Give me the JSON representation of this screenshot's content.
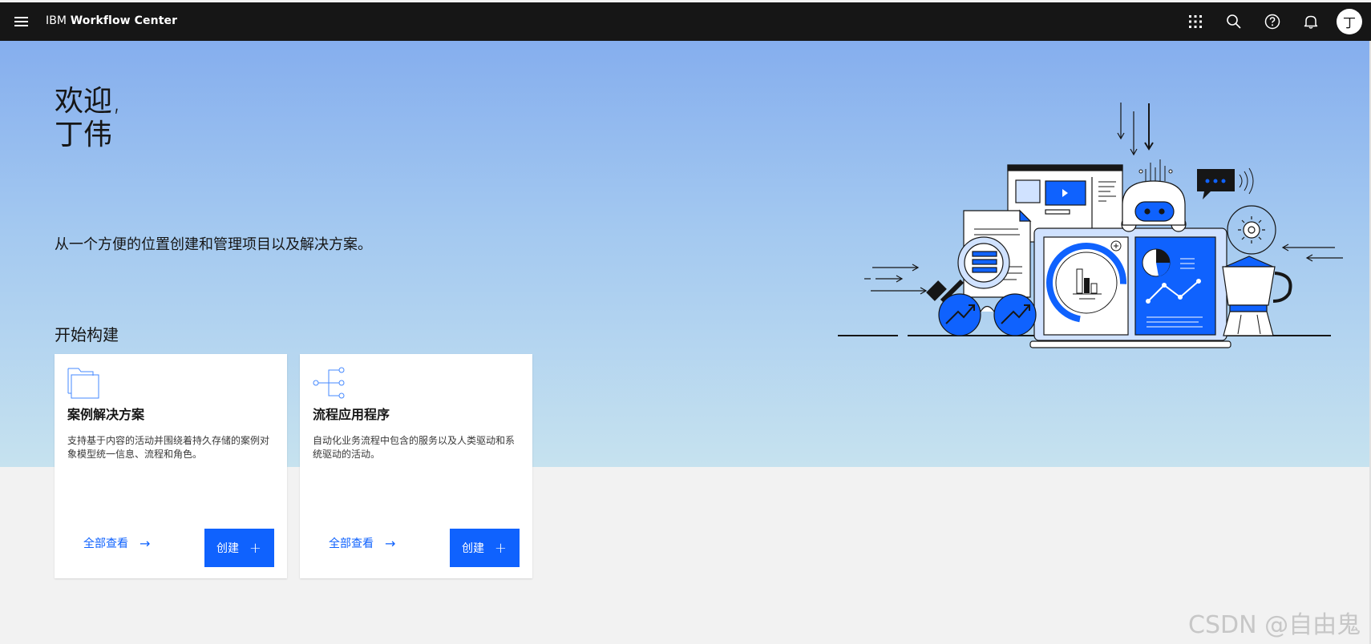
{
  "header": {
    "brand_prefix": "IBM",
    "brand_name": "Workflow Center",
    "avatar_initial": "丁",
    "icons": [
      "menu-icon",
      "app-switcher-icon",
      "search-icon",
      "help-icon",
      "notification-icon",
      "user-avatar"
    ]
  },
  "hero": {
    "welcome_line1": "欢迎,",
    "welcome_line2": "丁伟",
    "subtitle": "从一个方便的位置创建和管理项目以及解决方案。",
    "section_title": "开始构建"
  },
  "cards": [
    {
      "icon": "folder-icon",
      "title": "案例解决方案",
      "description": "支持基于内容的活动并围绕着持久存储的案例对象模型统一信息、流程和角色。",
      "view_all_label": "全部查看",
      "create_label": "创建"
    },
    {
      "icon": "flow-icon",
      "title": "流程应用程序",
      "description": "自动化业务流程中包含的服务以及人类驱动和系统驱动的活动。",
      "view_all_label": "全部查看",
      "create_label": "创建"
    }
  ],
  "watermark": "CSDN @自由鬼",
  "colors": {
    "topbar": "#161616",
    "primary": "#0f62fe",
    "hero_top": "#85aeee",
    "hero_bottom": "#c6e2ef",
    "page_bg": "#f2f2f2"
  }
}
